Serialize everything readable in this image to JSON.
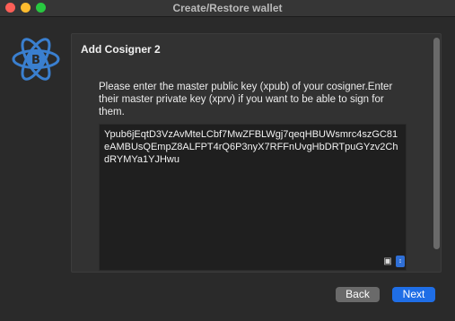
{
  "window": {
    "title": "Create/Restore wallet"
  },
  "page": {
    "title": "Add Cosigner 2",
    "instructions": "Please enter the master public key (xpub) of your cosigner.Enter their master private key (xprv) if you want to be able to sign for them."
  },
  "xpub_input": {
    "value": "Ypub6jEqtD3VzAvMteLCbf7MwZFBLWgj7qeqHBUWsmrc4szGC81eAMBUsQEmpZ8ALFPT4rQ6P3nyX7RFFnUvgHbDRTpuGYzv2ChdRYMYa1YJHwu"
  },
  "icons": {
    "logo": "electrum-bitcoin-logo",
    "camera": "camera-icon",
    "qr_menu": "qr-menu-icon"
  },
  "buttons": {
    "back": "Back",
    "next": "Next"
  },
  "colors": {
    "accent": "#1f6ee6",
    "logo": "#3a7fcf"
  }
}
